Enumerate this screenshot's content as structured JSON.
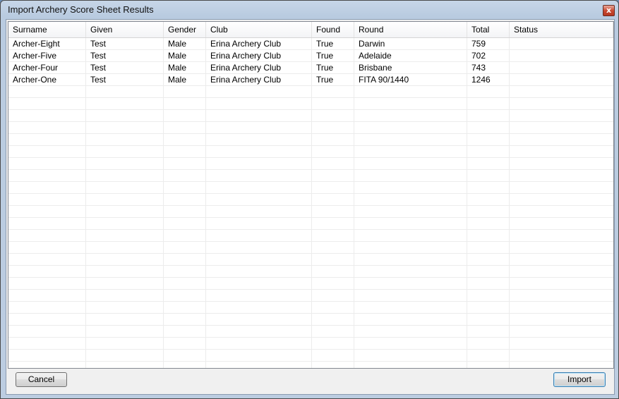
{
  "window": {
    "title": "Import Archery Score Sheet Results",
    "close_glyph": "x"
  },
  "table": {
    "columns": [
      "Surname",
      "Given",
      "Gender",
      "Club",
      "Found",
      "Round",
      "Total",
      "Status"
    ],
    "rows": [
      [
        "Archer-Eight",
        "Test",
        "Male",
        "Erina Archery Club",
        "True",
        "Darwin",
        "759",
        ""
      ],
      [
        "Archer-Five",
        "Test",
        "Male",
        "Erina Archery Club",
        "True",
        "Adelaide",
        "702",
        ""
      ],
      [
        "Archer-Four",
        "Test",
        "Male",
        "Erina Archery Club",
        "True",
        "Brisbane",
        "743",
        ""
      ],
      [
        "Archer-One",
        "Test",
        "Male",
        "Erina Archery Club",
        "True",
        "FITA 90/1440",
        "1246",
        ""
      ]
    ]
  },
  "buttons": {
    "cancel": "Cancel",
    "import": "Import"
  }
}
